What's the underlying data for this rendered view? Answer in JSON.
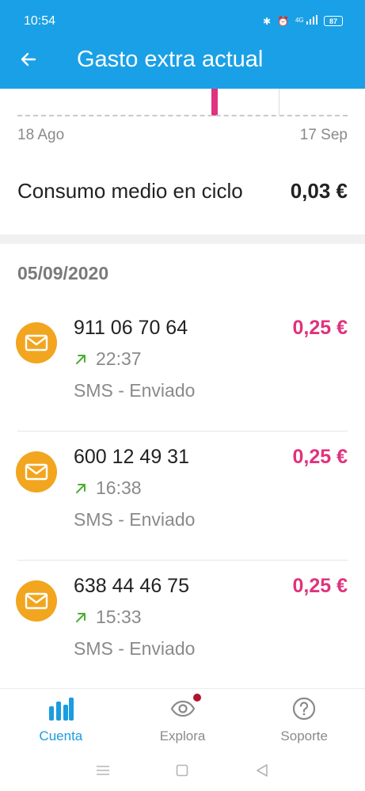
{
  "status_bar": {
    "time": "10:54",
    "bluetooth_glyph": "✱",
    "alarm_glyph": "⏰",
    "network": "4G",
    "battery": "87"
  },
  "header": {
    "title": "Gasto extra actual",
    "back_icon": "arrow-left-icon"
  },
  "chart": {
    "start_label": "18 Ago",
    "end_label": "17 Sep"
  },
  "average": {
    "label": "Consumo medio en ciclo",
    "value": "0,03 €"
  },
  "date_header": "05/09/2020",
  "records": [
    {
      "number": "911 06 70 64",
      "time": "22:37",
      "type": "SMS - Enviado",
      "amount": "0,25 €"
    },
    {
      "number": "600 12 49 31",
      "time": "16:38",
      "type": "SMS - Enviado",
      "amount": "0,25 €"
    },
    {
      "number": "638 44 46 75",
      "time": "15:33",
      "type": "SMS - Enviado",
      "amount": "0,25 €"
    }
  ],
  "nav": {
    "items": [
      {
        "label": "Cuenta",
        "icon": "bar-chart-icon",
        "active": true
      },
      {
        "label": "Explora",
        "icon": "eye-icon",
        "active": false,
        "badge": true
      },
      {
        "label": "Soporte",
        "icon": "help-circle-icon",
        "active": false
      }
    ]
  },
  "colors": {
    "primary": "#1aa0e6",
    "accent": "#e0327e",
    "icon_bg": "#f2a51f",
    "outgoing_arrow": "#4cae2e"
  }
}
